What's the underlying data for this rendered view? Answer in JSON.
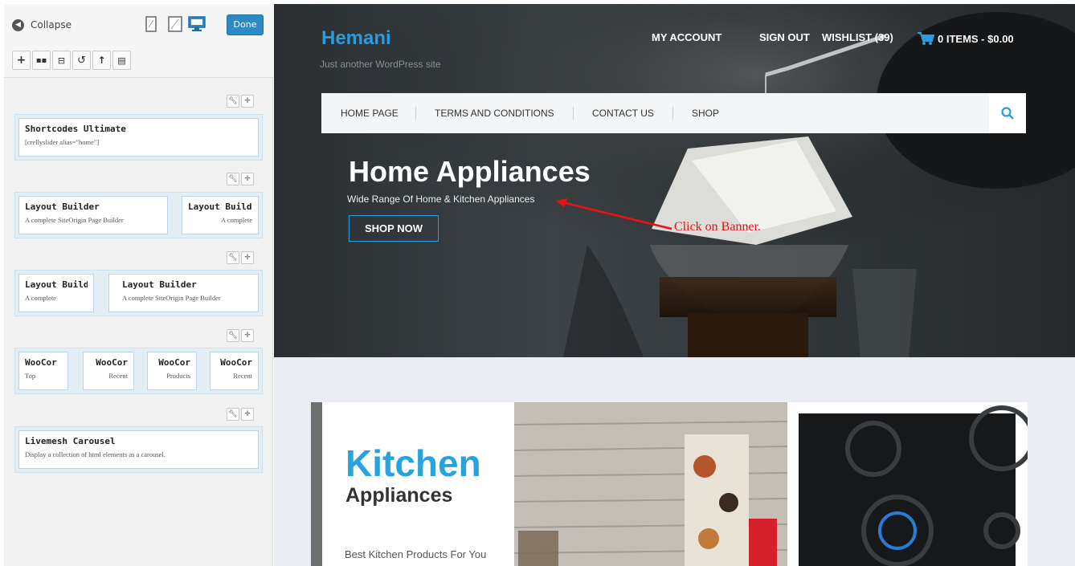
{
  "builder": {
    "collapse_label": "Collapse",
    "done_label": "Done",
    "rows": [
      {
        "widgets": [
          {
            "title": "Shortcodes Ultimate",
            "desc": "[crellyslider alias=\"home\"]"
          }
        ]
      },
      {
        "widgets": [
          {
            "title": "Layout Builder",
            "desc": "A complete SiteOrigin Page Builder"
          },
          {
            "title": "Layout Builde",
            "desc": "A complete"
          }
        ]
      },
      {
        "widgets": [
          {
            "title": "Layout Builde",
            "desc": "A complete"
          },
          {
            "title": "Layout Builder",
            "desc": "A complete SiteOrigin Page Builder"
          }
        ]
      },
      {
        "widgets": [
          {
            "title": "WooCor",
            "desc": "Top"
          },
          {
            "title": "WooCor",
            "desc": "Recent"
          },
          {
            "title": "WooCor",
            "desc": "Products"
          },
          {
            "title": "WooCor",
            "desc": "Recent"
          }
        ]
      },
      {
        "widgets": [
          {
            "title": "Livemesh Carousel",
            "desc": "Display a collection of html elements as a carousel."
          }
        ]
      }
    ]
  },
  "site": {
    "logo": "Hemani",
    "tagline": "Just another WordPress site",
    "top_links": [
      "MY ACCOUNT",
      "SIGN OUT",
      "WISHLIST (39)"
    ],
    "cart": "0 ITEMS - $0.00",
    "menu": [
      "HOME PAGE",
      "TERMS AND CONDITIONS",
      "CONTACT US",
      "SHOP"
    ],
    "hero": {
      "title": "Home Appliances",
      "subtitle": "Wide Range Of Home & Kitchen Appliances",
      "button": "SHOP NOW"
    },
    "annotation": "Click on Banner.",
    "promo": {
      "title": "Kitchen",
      "subtitle": "Appliances",
      "desc": "Best Kitchen Products For You"
    }
  }
}
